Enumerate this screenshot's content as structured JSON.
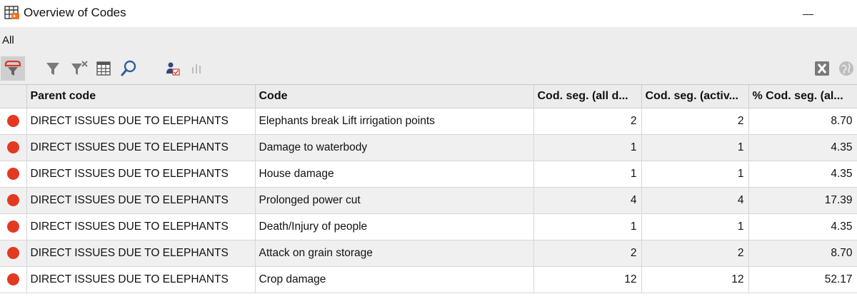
{
  "window": {
    "title": "Overview of Codes",
    "app_icon": "code-table-icon"
  },
  "filter_tabs": {
    "all_label": "All"
  },
  "toolbar": {
    "left_buttons": [
      "code-filter-icon",
      "filter-icon",
      "clear-filter-icon",
      "columns-icon",
      "search-icon",
      "user-check-icon",
      "chart-icon"
    ],
    "right_buttons": [
      "excel-export-icon",
      "web-export-icon"
    ]
  },
  "colors": {
    "code_dot": "#e23a22",
    "header_bg": "#ececec",
    "alt_row_bg": "#f0f0f0"
  },
  "table": {
    "columns": [
      "",
      "Parent code",
      "Code",
      "Cod. seg. (all d...",
      "Cod. seg. (activ...",
      "% Cod. seg. (al..."
    ],
    "rows": [
      {
        "parent": "DIRECT ISSUES DUE TO ELEPHANTS",
        "code": "Elephants break Lift irrigation points",
        "all": "2",
        "active": "2",
        "pct": "8.70"
      },
      {
        "parent": "DIRECT ISSUES DUE TO ELEPHANTS",
        "code": "Damage to waterbody",
        "all": "1",
        "active": "1",
        "pct": "4.35"
      },
      {
        "parent": "DIRECT ISSUES DUE TO ELEPHANTS",
        "code": "House damage",
        "all": "1",
        "active": "1",
        "pct": "4.35"
      },
      {
        "parent": "DIRECT ISSUES DUE TO ELEPHANTS",
        "code": "Prolonged power cut",
        "all": "4",
        "active": "4",
        "pct": "17.39"
      },
      {
        "parent": "DIRECT ISSUES DUE TO ELEPHANTS",
        "code": "Death/Injury of people",
        "all": "1",
        "active": "1",
        "pct": "4.35"
      },
      {
        "parent": "DIRECT ISSUES DUE TO ELEPHANTS",
        "code": "Attack on grain storage",
        "all": "2",
        "active": "2",
        "pct": "8.70"
      },
      {
        "parent": "DIRECT ISSUES DUE TO ELEPHANTS",
        "code": "Crop damage",
        "all": "12",
        "active": "12",
        "pct": "52.17"
      }
    ]
  }
}
